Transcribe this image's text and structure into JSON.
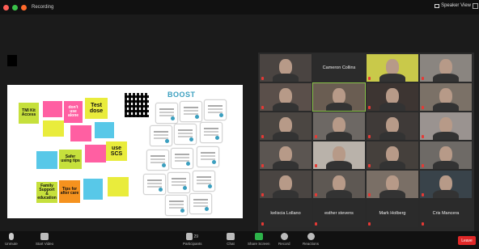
{
  "top_bar": {
    "recording_label": "Recording",
    "view_label": "Speaker View"
  },
  "shared_screen": {
    "boost_label": "BOOST",
    "notes": [
      {
        "text": "TMI Kit Access",
        "color": "#c6e03c"
      },
      {
        "text": "don't use alone",
        "color": "#ff5fa2"
      },
      {
        "text": "Test dose",
        "color": "#e9ec3c"
      },
      {
        "text": "Safer using tips",
        "color": "#c6e03c"
      },
      {
        "text": "use SCS",
        "color": "#e9ec3c"
      },
      {
        "text": "Family Support & education",
        "color": "#c6e03c"
      },
      {
        "text": "Tips for after care",
        "color": "#f5921e"
      }
    ]
  },
  "gallery": {
    "labels": [
      "Cameron Collins",
      "keliscia Lollano",
      "esther stevens",
      "Mark Holberg",
      "Cris Mancera"
    ]
  },
  "toolbar": {
    "items": [
      "Unmute",
      "Start Video",
      "Participants",
      "Chat",
      "Share Screen",
      "Record",
      "Reactions"
    ],
    "participants_count": "29",
    "leave_label": "Leave"
  },
  "colors": {
    "accent_green": "#8bc34a",
    "leave_red": "#e02828",
    "share_green": "#2db34a"
  }
}
